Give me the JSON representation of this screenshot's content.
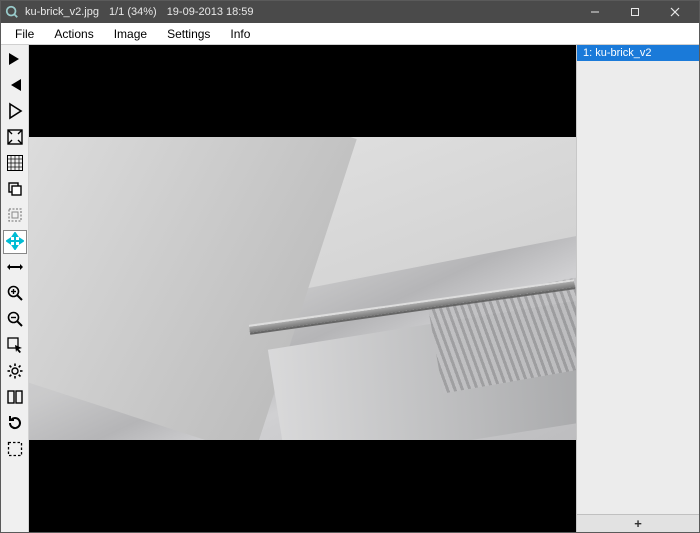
{
  "titlebar": {
    "filename": "ku-brick_v2.jpg",
    "position": "1/1 (34%)",
    "datetime": "19-09-2013 18:59"
  },
  "menu": {
    "file": "File",
    "actions": "Actions",
    "image": "Image",
    "settings": "Settings",
    "info": "Info"
  },
  "tools": [
    {
      "name": "next-image",
      "icon": "arrow-right"
    },
    {
      "name": "prev-image",
      "icon": "arrow-left"
    },
    {
      "name": "play-slideshow",
      "icon": "play"
    },
    {
      "name": "fit-screen",
      "icon": "fit"
    },
    {
      "name": "grid-view",
      "icon": "grid"
    },
    {
      "name": "copy",
      "icon": "copy"
    },
    {
      "name": "crop",
      "icon": "crop"
    },
    {
      "name": "move",
      "icon": "move",
      "active": true
    },
    {
      "name": "stretch",
      "icon": "stretch"
    },
    {
      "name": "zoom-in",
      "icon": "zoom-in"
    },
    {
      "name": "zoom-out",
      "icon": "zoom-out"
    },
    {
      "name": "pointer",
      "icon": "pointer"
    },
    {
      "name": "settings-gear",
      "icon": "gear"
    },
    {
      "name": "compare",
      "icon": "compare"
    },
    {
      "name": "rotate",
      "icon": "rotate"
    },
    {
      "name": "select",
      "icon": "select"
    }
  ],
  "sidepanel": {
    "items": [
      {
        "label": "1: ku-brick_v2",
        "selected": true
      }
    ],
    "add_label": "+"
  }
}
